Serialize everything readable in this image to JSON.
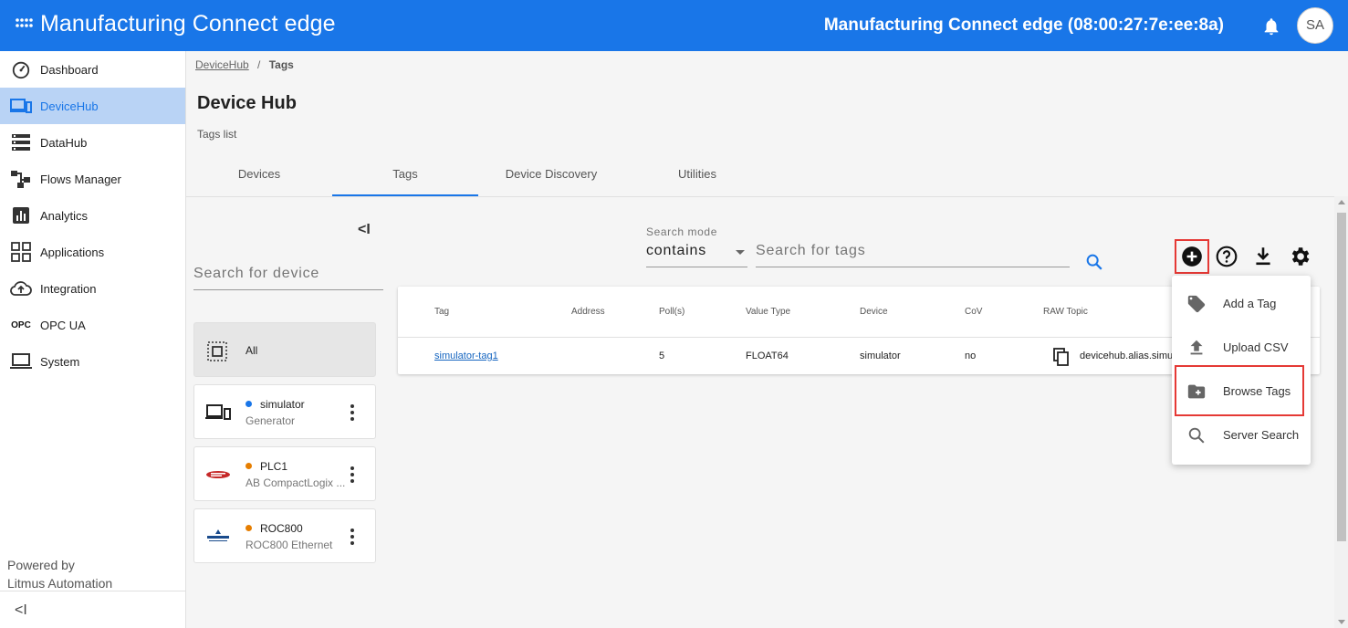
{
  "app": {
    "brand": "Manufacturing Connect edge",
    "device_title": "Manufacturing Connect edge (08:00:27:7e:ee:8a)",
    "avatar_initials": "SA",
    "accent_color": "#1976e8"
  },
  "sidebar": {
    "items": [
      {
        "label": "Dashboard",
        "icon": "speedometer-icon"
      },
      {
        "label": "DeviceHub",
        "icon": "devices-icon"
      },
      {
        "label": "DataHub",
        "icon": "storage-icon"
      },
      {
        "label": "Flows Manager",
        "icon": "flows-icon"
      },
      {
        "label": "Analytics",
        "icon": "analytics-icon"
      },
      {
        "label": "Applications",
        "icon": "apps-grid-icon"
      },
      {
        "label": "Integration",
        "icon": "cloud-upload-icon"
      },
      {
        "label": "OPC UA",
        "icon": "opc-text-icon"
      },
      {
        "label": "System",
        "icon": "laptop-icon"
      }
    ],
    "opc_glyph": "OPC",
    "powered_line1": "Powered by",
    "powered_line2": "Litmus Automation",
    "collapse_glyph": "<I"
  },
  "breadcrumb": {
    "parent": "DeviceHub",
    "separator": "/",
    "current": "Tags"
  },
  "page": {
    "title": "Device Hub",
    "subtitle": "Tags list"
  },
  "tabs": [
    "Devices",
    "Tags",
    "Device Discovery",
    "Utilities"
  ],
  "device_panel": {
    "collapse_glyph": "<I",
    "search_placeholder": "Search for device",
    "all_label": "All",
    "devices": [
      {
        "name": "simulator",
        "sub": "Generator",
        "status_color": "#1976e8"
      },
      {
        "name": "PLC1",
        "sub": "AB CompactLogix ...",
        "status_color": "#e67e00"
      },
      {
        "name": "ROC800",
        "sub": "ROC800 Ethernet",
        "status_color": "#e67e00"
      }
    ]
  },
  "search": {
    "mode_label": "Search mode",
    "mode_value": "contains",
    "placeholder": "Search for tags"
  },
  "table": {
    "headers": [
      "Tag",
      "Address",
      "Poll(s)",
      "Value Type",
      "Device",
      "CoV",
      "RAW Topic"
    ],
    "rows": [
      {
        "tag": "simulator-tag1",
        "address": "",
        "poll": "5",
        "value_type": "FLOAT64",
        "device": "simulator",
        "cov": "no",
        "raw_topic": "devicehub.alias.simu"
      }
    ]
  },
  "add_menu": {
    "items": [
      {
        "label": "Add a Tag",
        "icon": "tag-icon"
      },
      {
        "label": "Upload CSV",
        "icon": "upload-icon"
      },
      {
        "label": "Browse Tags",
        "icon": "folder-plus-icon"
      },
      {
        "label": "Server Search",
        "icon": "search-icon"
      }
    ],
    "highlight_color": "#e53935"
  }
}
